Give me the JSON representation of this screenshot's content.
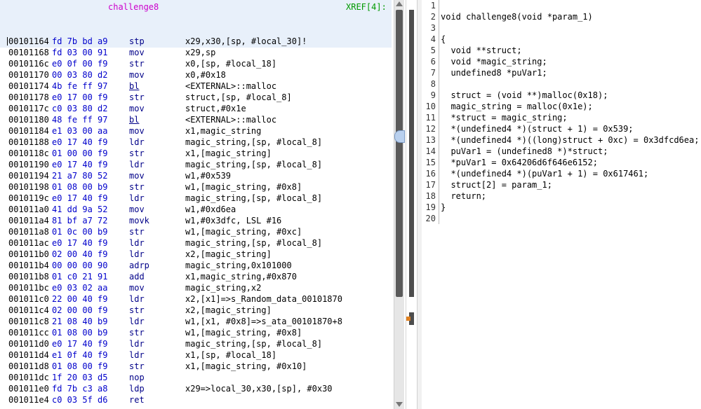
{
  "listing": {
    "function_label": "challenge8",
    "xref_label": "XREF[4]:",
    "rows": [
      {
        "addr": "00101164",
        "bytes": "fd 7b bd a9",
        "mnemonic": "stp",
        "operands": "x29,x30,[sp, #local_30]!",
        "call": false,
        "current": true
      },
      {
        "addr": "00101168",
        "bytes": "fd 03 00 91",
        "mnemonic": "mov",
        "operands": "x29,sp",
        "call": false,
        "current": false
      },
      {
        "addr": "0010116c",
        "bytes": "e0 0f 00 f9",
        "mnemonic": "str",
        "operands": "x0,[sp, #local_18]",
        "call": false,
        "current": false
      },
      {
        "addr": "00101170",
        "bytes": "00 03 80 d2",
        "mnemonic": "mov",
        "operands": "x0,#0x18",
        "call": false,
        "current": false
      },
      {
        "addr": "00101174",
        "bytes": "4b fe ff 97",
        "mnemonic": "bl",
        "operands": "<EXTERNAL>::malloc",
        "call": true,
        "current": false
      },
      {
        "addr": "00101178",
        "bytes": "e0 17 00 f9",
        "mnemonic": "str",
        "operands": "struct,[sp, #local_8]",
        "call": false,
        "current": false
      },
      {
        "addr": "0010117c",
        "bytes": "c0 03 80 d2",
        "mnemonic": "mov",
        "operands": "struct,#0x1e",
        "call": false,
        "current": false
      },
      {
        "addr": "00101180",
        "bytes": "48 fe ff 97",
        "mnemonic": "bl",
        "operands": "<EXTERNAL>::malloc",
        "call": true,
        "current": false
      },
      {
        "addr": "00101184",
        "bytes": "e1 03 00 aa",
        "mnemonic": "mov",
        "operands": "x1,magic_string",
        "call": false,
        "current": false
      },
      {
        "addr": "00101188",
        "bytes": "e0 17 40 f9",
        "mnemonic": "ldr",
        "operands": "magic_string,[sp, #local_8]",
        "call": false,
        "current": false
      },
      {
        "addr": "0010118c",
        "bytes": "01 00 00 f9",
        "mnemonic": "str",
        "operands": "x1,[magic_string]",
        "call": false,
        "current": false
      },
      {
        "addr": "00101190",
        "bytes": "e0 17 40 f9",
        "mnemonic": "ldr",
        "operands": "magic_string,[sp, #local_8]",
        "call": false,
        "current": false
      },
      {
        "addr": "00101194",
        "bytes": "21 a7 80 52",
        "mnemonic": "mov",
        "operands": "w1,#0x539",
        "call": false,
        "current": false
      },
      {
        "addr": "00101198",
        "bytes": "01 08 00 b9",
        "mnemonic": "str",
        "operands": "w1,[magic_string, #0x8]",
        "call": false,
        "current": false
      },
      {
        "addr": "0010119c",
        "bytes": "e0 17 40 f9",
        "mnemonic": "ldr",
        "operands": "magic_string,[sp, #local_8]",
        "call": false,
        "current": false
      },
      {
        "addr": "001011a0",
        "bytes": "41 dd 9a 52",
        "mnemonic": "mov",
        "operands": "w1,#0xd6ea",
        "call": false,
        "current": false
      },
      {
        "addr": "001011a4",
        "bytes": "81 bf a7 72",
        "mnemonic": "movk",
        "operands": "w1,#0x3dfc, LSL #16",
        "call": false,
        "current": false
      },
      {
        "addr": "001011a8",
        "bytes": "01 0c 00 b9",
        "mnemonic": "str",
        "operands": "w1,[magic_string, #0xc]",
        "call": false,
        "current": false
      },
      {
        "addr": "001011ac",
        "bytes": "e0 17 40 f9",
        "mnemonic": "ldr",
        "operands": "magic_string,[sp, #local_8]",
        "call": false,
        "current": false
      },
      {
        "addr": "001011b0",
        "bytes": "02 00 40 f9",
        "mnemonic": "ldr",
        "operands": "x2,[magic_string]",
        "call": false,
        "current": false
      },
      {
        "addr": "001011b4",
        "bytes": "00 00 00 90",
        "mnemonic": "adrp",
        "operands": "magic_string,0x101000",
        "call": false,
        "current": false
      },
      {
        "addr": "001011b8",
        "bytes": "01 c0 21 91",
        "mnemonic": "add",
        "operands": "x1,magic_string,#0x870",
        "call": false,
        "current": false
      },
      {
        "addr": "001011bc",
        "bytes": "e0 03 02 aa",
        "mnemonic": "mov",
        "operands": "magic_string,x2",
        "call": false,
        "current": false
      },
      {
        "addr": "001011c0",
        "bytes": "22 00 40 f9",
        "mnemonic": "ldr",
        "operands": "x2,[x1]=>s_Random_data_00101870",
        "call": false,
        "current": false
      },
      {
        "addr": "001011c4",
        "bytes": "02 00 00 f9",
        "mnemonic": "str",
        "operands": "x2,[magic_string]",
        "call": false,
        "current": false
      },
      {
        "addr": "001011c8",
        "bytes": "21 08 40 b9",
        "mnemonic": "ldr",
        "operands": "w1,[x1, #0x8]=>s_ata_00101870+8",
        "call": false,
        "current": false
      },
      {
        "addr": "001011cc",
        "bytes": "01 08 00 b9",
        "mnemonic": "str",
        "operands": "w1,[magic_string, #0x8]",
        "call": false,
        "current": false
      },
      {
        "addr": "001011d0",
        "bytes": "e0 17 40 f9",
        "mnemonic": "ldr",
        "operands": "magic_string,[sp, #local_8]",
        "call": false,
        "current": false
      },
      {
        "addr": "001011d4",
        "bytes": "e1 0f 40 f9",
        "mnemonic": "ldr",
        "operands": "x1,[sp, #local_18]",
        "call": false,
        "current": false
      },
      {
        "addr": "001011d8",
        "bytes": "01 08 00 f9",
        "mnemonic": "str",
        "operands": "x1,[magic_string, #0x10]",
        "call": false,
        "current": false
      },
      {
        "addr": "001011dc",
        "bytes": "1f 20 03 d5",
        "mnemonic": "nop",
        "operands": "",
        "call": false,
        "current": false
      },
      {
        "addr": "001011e0",
        "bytes": "fd 7b c3 a8",
        "mnemonic": "ldp",
        "operands": "x29=>local_30,x30,[sp], #0x30",
        "call": false,
        "current": false
      },
      {
        "addr": "001011e4",
        "bytes": "c0 03 5f d6",
        "mnemonic": "ret",
        "operands": "",
        "call": false,
        "current": false
      }
    ]
  },
  "decompiler": {
    "line_numbers": [
      "1",
      "2",
      "3",
      "4",
      "5",
      "6",
      "7",
      "8",
      "9",
      "10",
      "11",
      "12",
      "13",
      "14",
      "15",
      "16",
      "17",
      "18",
      "19",
      "20"
    ],
    "lines": [
      "",
      "void challenge8(void *param_1)",
      "",
      "{",
      "  void **struct;",
      "  void *magic_string;",
      "  undefined8 *puVar1;",
      "",
      "  struct = (void **)malloc(0x18);",
      "  magic_string = malloc(0x1e);",
      "  *struct = magic_string;",
      "  *(undefined4 *)(struct + 1) = 0x539;",
      "  *(undefined4 *)((long)struct + 0xc) = 0x3dfcd6ea;",
      "  puVar1 = (undefined8 *)*struct;",
      "  *puVar1 = 0x64206d6f646e6152;",
      "  *(undefined4 *)(puVar1 + 1) = 0x617461;",
      "  struct[2] = param_1;",
      "  return;",
      "}",
      ""
    ]
  }
}
